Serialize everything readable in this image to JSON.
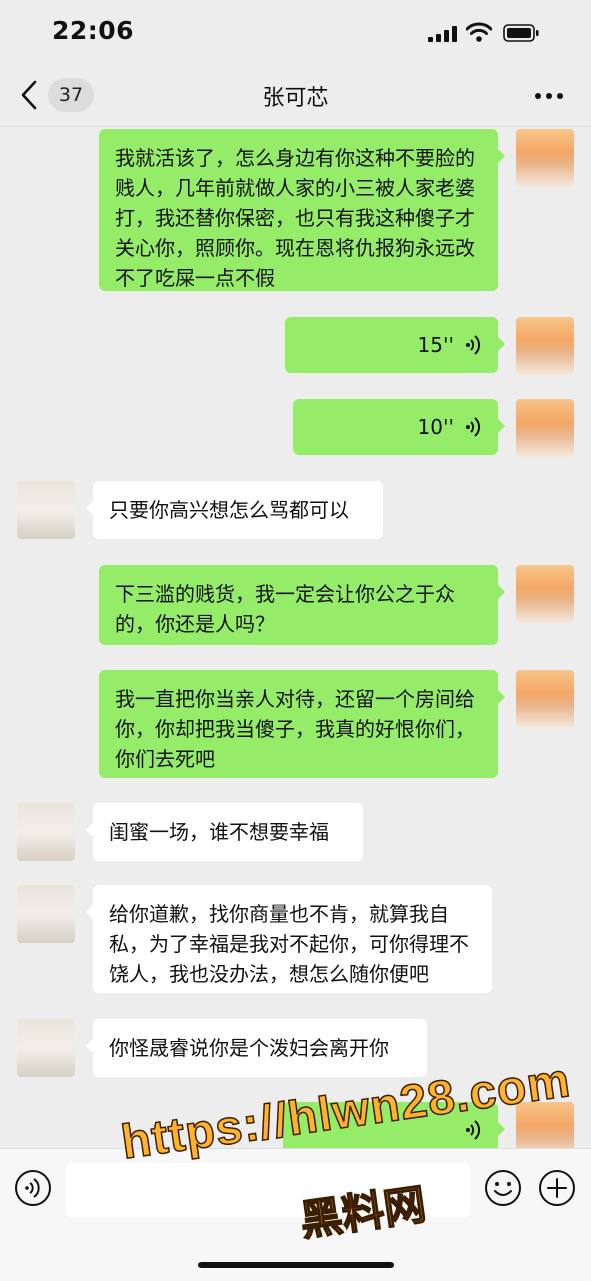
{
  "status_bar": {
    "time": "22:06"
  },
  "nav": {
    "back_icon": "chevron-left-icon",
    "unread_count": "37",
    "title": "张可芯",
    "more_icon": "more-dots-icon"
  },
  "messages": [
    {
      "from": "self",
      "type": "text",
      "text": "我就活该了，怎么身边有你这种不要脸的贱人，几年前就做人家的小三被人家老婆打，我还替你保密，也只有我这种傻子才关心你，照顾你。现在恩将仇报狗永远改不了吃屎一点不假"
    },
    {
      "from": "self",
      "type": "voice",
      "duration": "15''"
    },
    {
      "from": "self",
      "type": "voice",
      "duration": "10''"
    },
    {
      "from": "other",
      "type": "text",
      "text": "只要你高兴想怎么骂都可以"
    },
    {
      "from": "self",
      "type": "text",
      "text": "下三滥的贱货，我一定会让你公之于众的，你还是人吗？"
    },
    {
      "from": "self",
      "type": "text",
      "text": "我一直把你当亲人对待，还留一个房间给你，你却把我当傻子，我真的好恨你们，你们去死吧"
    },
    {
      "from": "other",
      "type": "text",
      "text": "闺蜜一场，谁不想要幸福"
    },
    {
      "from": "other",
      "type": "text",
      "text": "给你道歉，找你商量也不肯，就算我自私，为了幸福是我对不起你，可你得理不饶人，我也没办法，想怎么随你便吧"
    },
    {
      "from": "other",
      "type": "text",
      "text": "你怪晟睿说你是个泼妇会离开你"
    },
    {
      "from": "self",
      "type": "voice",
      "duration": ""
    }
  ],
  "input_bar": {
    "voice_icon": "voice-input-icon",
    "emoji_icon": "emoji-icon",
    "plus_icon": "plus-icon"
  },
  "watermark": {
    "url": "https://hlwn28.com",
    "name": "黑料网"
  },
  "colors": {
    "sent_bubble": "#95ec69",
    "received_bubble": "#ffffff",
    "background": "#ededed"
  }
}
